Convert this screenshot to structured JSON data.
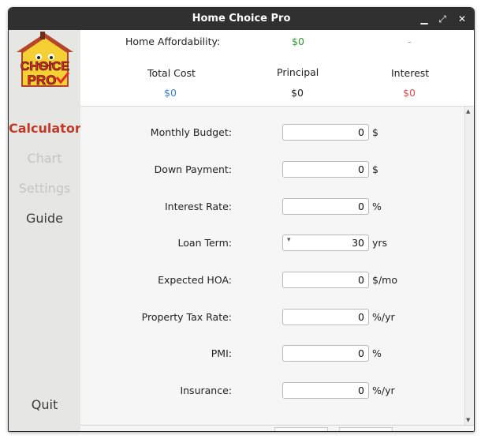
{
  "window": {
    "title": "Home Choice Pro"
  },
  "logo": {
    "text_top": "CHOICE",
    "text_bottom": "PRO"
  },
  "nav": {
    "calculator": "Calculator",
    "chart": "Chart",
    "settings": "Settings",
    "guide": "Guide",
    "quit": "Quit"
  },
  "summary": {
    "affordability_label": "Home Affordability:",
    "affordability_value": "$0",
    "affordability_extra": "-",
    "total_cost_label": "Total Cost",
    "total_cost_value": "$0",
    "principal_label": "Principal",
    "principal_value": "$0",
    "interest_label": "Interest",
    "interest_value": "$0"
  },
  "form": {
    "monthly_budget": {
      "label": "Monthly Budget:",
      "value": "0",
      "unit": "$"
    },
    "down_payment": {
      "label": "Down Payment:",
      "value": "0",
      "unit": "$"
    },
    "interest_rate": {
      "label": "Interest Rate:",
      "value": "0",
      "unit": "%"
    },
    "loan_term": {
      "label": "Loan Term:",
      "value": "30",
      "unit": "yrs"
    },
    "expected_hoa": {
      "label": "Expected HOA:",
      "value": "0",
      "unit": "$/mo"
    },
    "property_tax_rate": {
      "label": "Property Tax Rate:",
      "value": "0",
      "unit": "%/yr"
    },
    "pmi": {
      "label": "PMI:",
      "value": "0",
      "unit": "%"
    },
    "insurance": {
      "label": "Insurance:",
      "value": "0",
      "unit": "%/yr"
    }
  },
  "colors": {
    "accent_red": "#c0392b",
    "green": "#2e9a2e",
    "blue": "#3a7fd0",
    "red": "#e05050"
  },
  "icons": {
    "minimize": "minimize-icon",
    "maximize": "maximize-icon",
    "close": "close-icon",
    "arrow": "arrow-left-icon",
    "dropdown": "chevron-down-icon"
  }
}
